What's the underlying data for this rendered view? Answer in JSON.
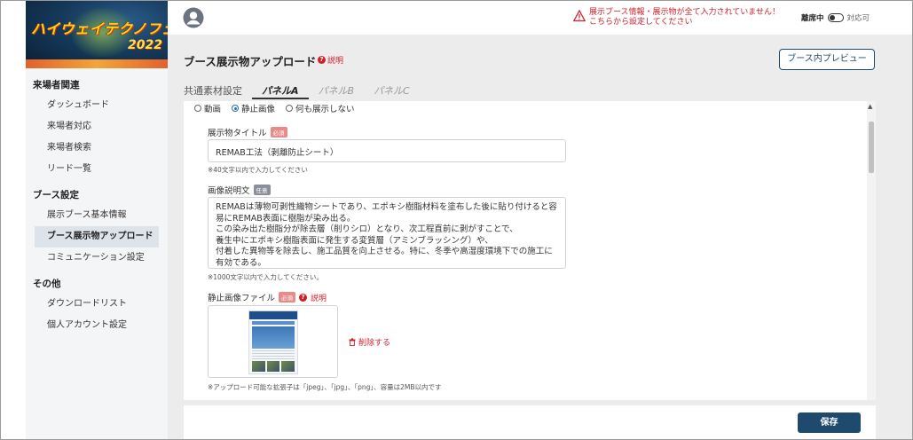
{
  "brand": {
    "logo_text": "ハイウェイテクノフェア",
    "logo_year": "2022"
  },
  "topbar": {
    "warning_line1": "展示ブース情報・展示物が全て入力されていません！",
    "warning_line2": "こちらから設定してください",
    "away_label": "離席中",
    "away_state": "対応可"
  },
  "sidebar": {
    "sections": [
      {
        "title": "来場者関連",
        "items": [
          "ダッシュボード",
          "来場者対応",
          "来場者検索",
          "リード一覧"
        ]
      },
      {
        "title": "ブース設定",
        "items": [
          "展示ブース基本情報",
          "ブース展示物アップロード",
          "コミュニケーション設定"
        ]
      },
      {
        "title": "その他",
        "items": [
          "ダウンロードリスト",
          "個人アカウント設定"
        ]
      }
    ]
  },
  "page": {
    "title": "ブース展示物アップロード",
    "help": "説明",
    "preview_button": "ブース内プレビュー"
  },
  "tabs": [
    "共通素材設定",
    "パネルA",
    "パネルB",
    "パネルC"
  ],
  "form": {
    "display_options": [
      "動画",
      "静止画像",
      "何も展示しない"
    ],
    "selected_option": "静止画像",
    "title_label": "展示物タイトル",
    "required_badge": "必須",
    "optional_badge": "任意",
    "title_value": "REMAB工法（剥離防止シート）",
    "title_hint": "※40文字以内で入力してください",
    "desc_label": "画像説明文",
    "desc_value": "REMABは薄物可剥性織物シートであり、エポキシ樹脂材料を塗布した後に貼り付けると容\n易にREMAB表面に樹脂が染み出る。\nこの染み出た樹脂分が除去層（削りシロ）となり、次工程直前に剥がすことで、\n養生中にエポキシ樹脂表面に発生する変質層（アミンブラッシング）や、\n付着した異物等を除去し、施工品質を向上させる。特に、冬季や高湿度環境下での施工に\n有効である。",
    "desc_hint": "※1000文字以内で入力してください。",
    "image_label": "静止画像ファイル",
    "image_help": "説明",
    "delete_label": "削除する",
    "image_hint": "※アップロード可能な拡張子は「jpeg」、「jpg」、「png」、容量は2MB以内です"
  },
  "footer": {
    "save_label": "保存"
  },
  "colors": {
    "primary": "#1e4a6e",
    "warning": "#d11f2a",
    "sidebar_bg": "#f4f5f7",
    "main_bg": "#ececec"
  }
}
